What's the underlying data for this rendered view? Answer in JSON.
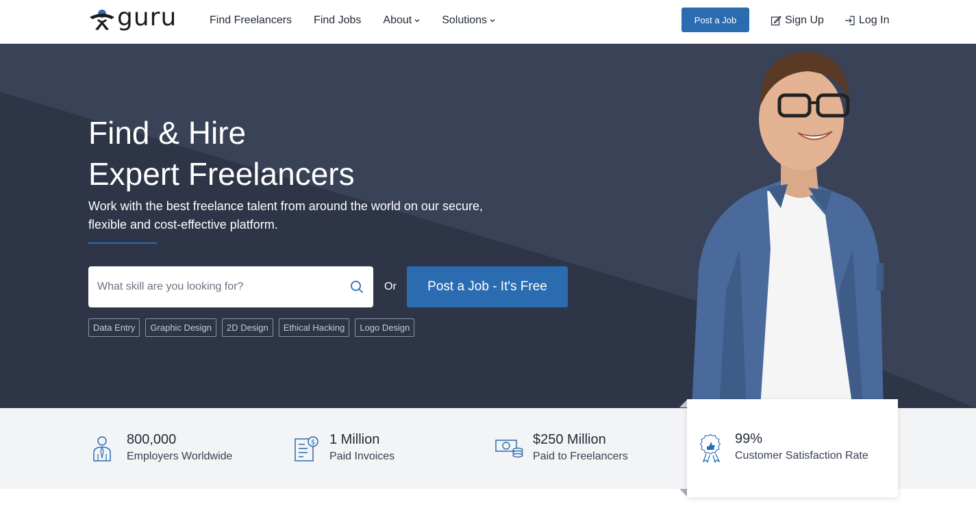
{
  "header": {
    "logo_text": "guru",
    "nav": [
      {
        "label": "Find Freelancers",
        "dropdown": false
      },
      {
        "label": "Find Jobs",
        "dropdown": false
      },
      {
        "label": "About",
        "dropdown": true
      },
      {
        "label": "Solutions",
        "dropdown": true
      }
    ],
    "post_job_label": "Post a Job",
    "signup_label": "Sign Up",
    "login_label": "Log In"
  },
  "hero": {
    "title_line1": "Find & Hire",
    "title_line2": "Expert Freelancers",
    "subtitle": "Work with the best freelance talent from around the world on our secure, flexible and cost-effective platform.",
    "search_placeholder": "What skill are you looking for?",
    "or_text": "Or",
    "post_button": "Post a Job - It's Free",
    "tags": [
      "Data Entry",
      "Graphic Design",
      "2D Design",
      "Ethical Hacking",
      "Logo Design"
    ]
  },
  "stats": [
    {
      "number": "800,000",
      "label": "Employers Worldwide",
      "icon": "employer-icon"
    },
    {
      "number": "1 Million",
      "label": "Paid Invoices",
      "icon": "invoice-icon"
    },
    {
      "number": "$250 Million",
      "label": "Paid to Freelancers",
      "icon": "money-icon"
    },
    {
      "number": "99%",
      "label": "Customer Satisfaction Rate",
      "icon": "award-icon"
    }
  ],
  "colors": {
    "brand_blue": "#2b6cb0",
    "hero_bg": "#2e3547",
    "stats_bg": "#f3f4f6"
  }
}
